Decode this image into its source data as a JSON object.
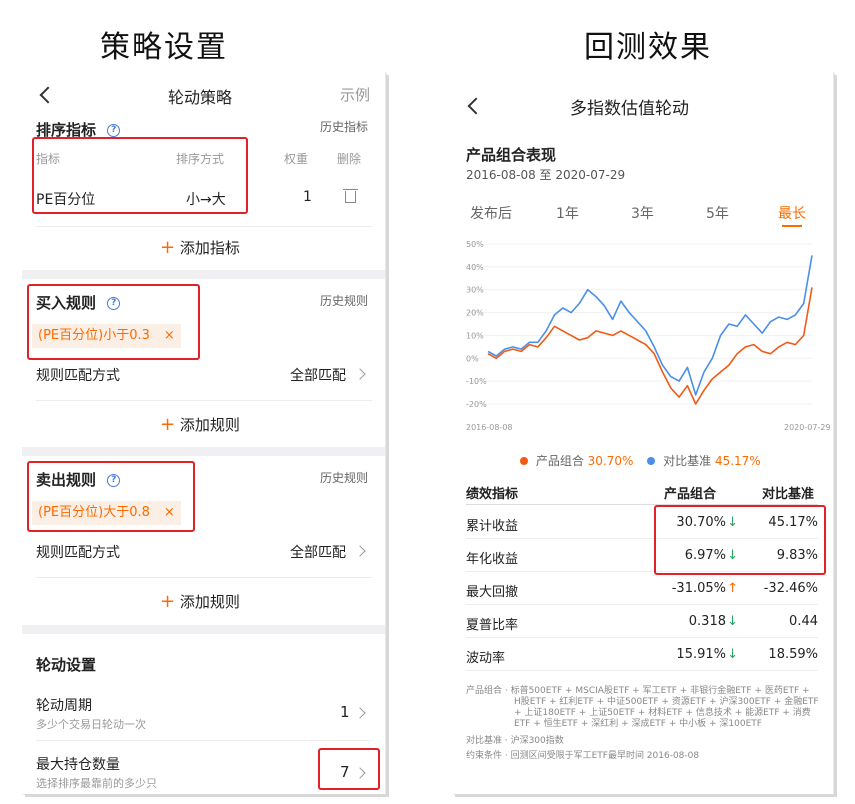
{
  "captions": {
    "left": "策略设置",
    "right": "回测效果"
  },
  "left": {
    "title": "轮动策略",
    "example": "示例",
    "sort": {
      "title": "排序指标",
      "history": "历史指标",
      "headers": {
        "indicator": "指标",
        "method": "排序方式",
        "weight": "权重",
        "delete": "删除"
      },
      "row": {
        "indicator": "PE百分位",
        "method": "小→大",
        "weight": "1"
      },
      "add": "添加指标"
    },
    "buy": {
      "title": "买入规则",
      "history": "历史规则",
      "chip": "(PE百分位)小于0.3",
      "chip_close": "×",
      "match_label": "规则匹配方式",
      "match_value": "全部匹配",
      "add": "添加规则"
    },
    "sell": {
      "title": "卖出规则",
      "history": "历史规则",
      "chip": "(PE百分位)大于0.8",
      "chip_close": "×",
      "match_label": "规则匹配方式",
      "match_value": "全部匹配",
      "add": "添加规则"
    },
    "rotation": {
      "title": "轮动设置",
      "period": {
        "label": "轮动周期",
        "sub": "多少个交易日轮动一次",
        "value": "1"
      },
      "max": {
        "label": "最大持仓数量",
        "sub": "选择排序最靠前的多少只",
        "value": "7"
      }
    },
    "plus": "+"
  },
  "right": {
    "title": "多指数估值轮动",
    "perf_title": "产品组合表现",
    "date_range": "2016-08-08 至 2020-07-29",
    "tabs": [
      "发布后",
      "1年",
      "3年",
      "5年",
      "最长"
    ],
    "legend": {
      "product": "产品组合",
      "product_value": "30.70%",
      "bench": "对比基准",
      "bench_value": "45.17%"
    },
    "table": {
      "headers": [
        "绩效指标",
        "产品组合",
        "对比基准"
      ],
      "rows": [
        {
          "name": "累计收益",
          "product": "30.70%",
          "arrow": "↓",
          "bench": "45.17%"
        },
        {
          "name": "年化收益",
          "product": "6.97%",
          "arrow": "↓",
          "bench": "9.83%"
        },
        {
          "name": "最大回撤",
          "product": "-31.05%",
          "arrow": "↑",
          "bench": "-32.46%"
        },
        {
          "name": "夏普比率",
          "product": "0.318",
          "arrow": "↓",
          "bench": "0.44"
        },
        {
          "name": "波动率",
          "product": "15.91%",
          "arrow": "↓",
          "bench": "18.59%"
        }
      ]
    },
    "footer": {
      "l1": "产品组合 · 标普500ETF + MSCIA股ETF + 军工ETF + 非银行金融ETF + 医药ETF +",
      "l2": "H股ETF + 红利ETF + 中证500ETF + 资源ETF + 沪深300ETF + 金融ETF",
      "l3": "+ 上证180ETF + 上证50ETF + 材料ETF + 信息技术 + 能源ETF + 消费",
      "l4": "ETF + 恒生ETF + 深红利 + 深成ETF + 中小板 + 深100ETF",
      "l5": "对比基准 · 沪深300指数",
      "l6": "约束条件 · 回测区间受限于军工ETF最早时间 2016-08-08"
    }
  },
  "chart_data": {
    "type": "line",
    "x_start_label": "2016-08-08",
    "x_end_label": "2020-07-29",
    "ylim": [
      -20,
      50
    ],
    "yticks": [
      "50%",
      "40%",
      "30%",
      "20%",
      "10%",
      "0%",
      "-10%",
      "-20%"
    ],
    "colors": {
      "product": "#f05a14",
      "bench": "#4a8fe8"
    },
    "series": [
      {
        "name": "产品组合",
        "values": [
          2,
          0,
          3,
          4,
          3,
          6,
          5,
          9,
          14,
          12,
          10,
          8,
          9,
          12,
          11,
          10,
          12,
          10,
          8,
          6,
          2,
          -6,
          -13,
          -17,
          -12,
          -20,
          -14,
          -9,
          -6,
          -3,
          2,
          5,
          6,
          3,
          2,
          5,
          7,
          6,
          10,
          31
        ]
      },
      {
        "name": "对比基准",
        "values": [
          3,
          1,
          4,
          5,
          4,
          7,
          7,
          12,
          19,
          22,
          20,
          24,
          30,
          27,
          23,
          17,
          25,
          20,
          16,
          12,
          5,
          -3,
          -8,
          -10,
          -4,
          -16,
          -6,
          0,
          10,
          15,
          14,
          19,
          15,
          11,
          16,
          18,
          17,
          19,
          24,
          45
        ]
      }
    ]
  }
}
